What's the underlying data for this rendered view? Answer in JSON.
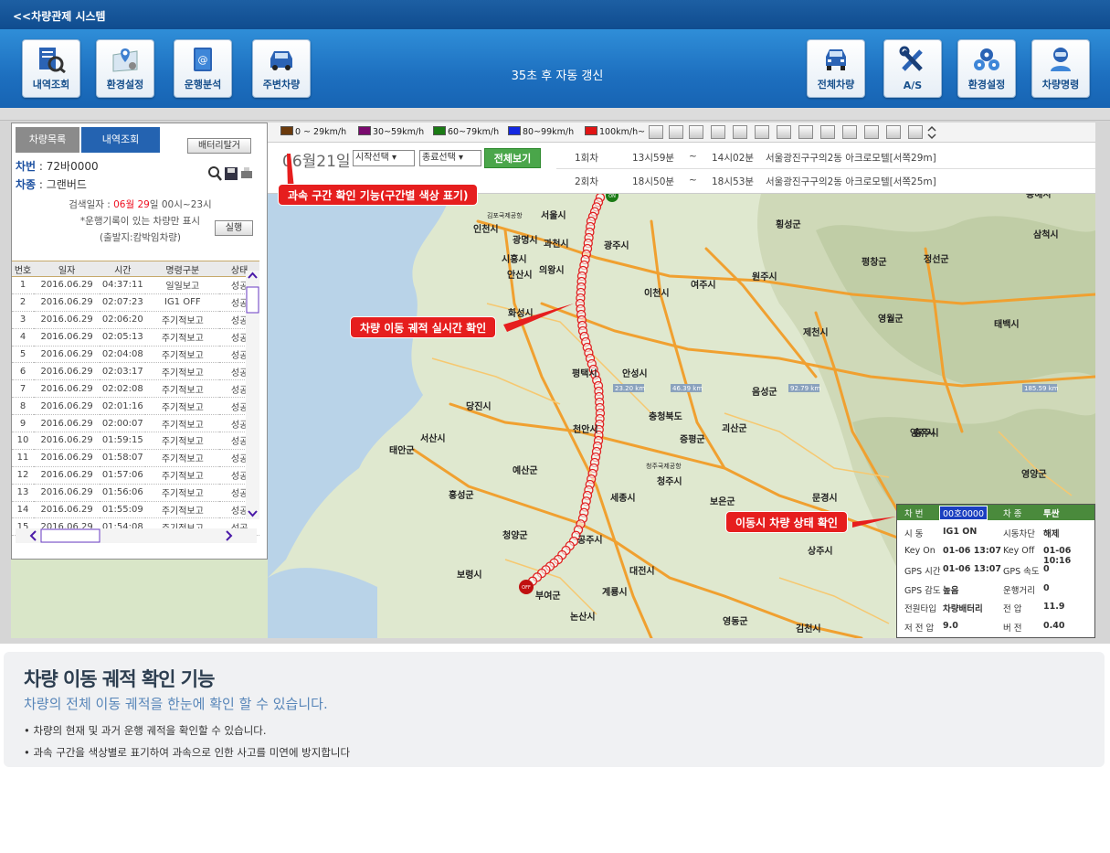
{
  "app": {
    "title": "<<차량관제 시스템"
  },
  "toolbar": {
    "left_buttons": [
      {
        "label": "내역조회",
        "icon": "history-search-icon"
      },
      {
        "label": "환경설정",
        "icon": "map-pin-settings-icon"
      },
      {
        "label": "운행분석",
        "icon": "analysis-notebook-icon"
      },
      {
        "label": "주변차량",
        "icon": "nearby-car-icon"
      }
    ],
    "refresh_text": "35초 후 자동 갱신",
    "right_buttons": [
      {
        "label": "전체차량",
        "icon": "all-vehicles-icon"
      },
      {
        "label": "A/S",
        "icon": "tools-icon"
      },
      {
        "label": "환경설정",
        "icon": "gears-icon"
      },
      {
        "label": "차량명령",
        "icon": "robot-command-icon"
      }
    ]
  },
  "left_panel": {
    "tabs": [
      "차량목록",
      "내역조회"
    ],
    "battery_button": "배터리탈거",
    "plate_key": "차번",
    "plate_value": "72바0000",
    "type_key": "차종",
    "type_value": "그랜버드",
    "search_date_prefix": "검색일자 : ",
    "search_date_month": "06월",
    "search_date_day": "29",
    "search_date_suffix": "일 00시~23시",
    "note1": "*운행기록이 있는 차량만 표시",
    "note2": "(출발지:캄박임차량)",
    "run_button": "실행",
    "columns": [
      "번호",
      "일자",
      "시간",
      "명령구분",
      "상태"
    ],
    "rows": [
      [
        "1",
        "2016.06.29",
        "04:37:11",
        "일일보고",
        "성공"
      ],
      [
        "2",
        "2016.06.29",
        "02:07:23",
        "IG1 OFF",
        "성공"
      ],
      [
        "3",
        "2016.06.29",
        "02:06:20",
        "주기적보고",
        "성공"
      ],
      [
        "4",
        "2016.06.29",
        "02:05:13",
        "주기적보고",
        "성공"
      ],
      [
        "5",
        "2016.06.29",
        "02:04:08",
        "주기적보고",
        "성공"
      ],
      [
        "6",
        "2016.06.29",
        "02:03:17",
        "주기적보고",
        "성공"
      ],
      [
        "7",
        "2016.06.29",
        "02:02:08",
        "주기적보고",
        "성공"
      ],
      [
        "8",
        "2016.06.29",
        "02:01:16",
        "주기적보고",
        "성공"
      ],
      [
        "9",
        "2016.06.29",
        "02:00:07",
        "주기적보고",
        "성공"
      ],
      [
        "10",
        "2016.06.29",
        "01:59:15",
        "주기적보고",
        "성공"
      ],
      [
        "11",
        "2016.06.29",
        "01:58:07",
        "주기적보고",
        "성공"
      ],
      [
        "12",
        "2016.06.29",
        "01:57:06",
        "주기적보고",
        "성공"
      ],
      [
        "13",
        "2016.06.29",
        "01:56:06",
        "주기적보고",
        "성공"
      ],
      [
        "14",
        "2016.06.29",
        "01:55:09",
        "주기적보고",
        "성공"
      ],
      [
        "15",
        "2016.06.29",
        "01:54:08",
        "주기적보고",
        "성공"
      ]
    ]
  },
  "map_toolbar": {
    "legend": [
      {
        "label": "0 ~ 29km/h",
        "color": "#6b3a0c"
      },
      {
        "label": "30~59km/h",
        "color": "#7a0a6e"
      },
      {
        "label": "60~79km/h",
        "color": "#1a7a14"
      },
      {
        "label": "80~99km/h",
        "color": "#1428e0"
      },
      {
        "label": "100km/h~",
        "color": "#e01414"
      }
    ]
  },
  "date_bar": {
    "date": "06월21일",
    "start_select": "시작선택",
    "end_select": "종료선택",
    "show_button": "전체보기",
    "trips": [
      {
        "no": "1회차",
        "start": "13시59분",
        "sep": "~",
        "end": "14시02분",
        "place": "서울광진구구의2동 아크로모텔[서쪽29m]"
      },
      {
        "no": "2회차",
        "start": "18시50분",
        "sep": "~",
        "end": "18시53분",
        "place": "서울광진구구의2동 아크로모텔[서쪽25m]"
      }
    ]
  },
  "map": {
    "cities": [
      {
        "name": "서울시"
      },
      {
        "name": "인천시"
      },
      {
        "name": "광명시"
      },
      {
        "name": "과천시"
      },
      {
        "name": "광주시"
      },
      {
        "name": "시흥시"
      },
      {
        "name": "의왕시"
      },
      {
        "name": "안산시"
      },
      {
        "name": "화성시"
      },
      {
        "name": "이천시"
      },
      {
        "name": "여주시"
      },
      {
        "name": "원주시"
      },
      {
        "name": "횡성군"
      },
      {
        "name": "평창군"
      },
      {
        "name": "정선군"
      },
      {
        "name": "영월군"
      },
      {
        "name": "태백시"
      },
      {
        "name": "제천시"
      },
      {
        "name": "충주시"
      },
      {
        "name": "음성군"
      },
      {
        "name": "평택시"
      },
      {
        "name": "안성시"
      },
      {
        "name": "당진시"
      },
      {
        "name": "충청북도"
      },
      {
        "name": "증평군"
      },
      {
        "name": "괴산군"
      },
      {
        "name": "천안시"
      },
      {
        "name": "서산시"
      },
      {
        "name": "태안군"
      },
      {
        "name": "예산군"
      },
      {
        "name": "청주시"
      },
      {
        "name": "홍성군"
      },
      {
        "name": "세종시"
      },
      {
        "name": "청양군"
      },
      {
        "name": "공주시"
      },
      {
        "name": "보령시"
      },
      {
        "name": "부여군"
      },
      {
        "name": "계룡시"
      },
      {
        "name": "대전시"
      },
      {
        "name": "논산시"
      },
      {
        "name": "상주시"
      },
      {
        "name": "영동군"
      },
      {
        "name": "김천시"
      },
      {
        "name": "예천군"
      },
      {
        "name": "영주시"
      },
      {
        "name": "영양군"
      },
      {
        "name": "삼척시"
      },
      {
        "name": "동해시"
      },
      {
        "name": "문경시"
      },
      {
        "name": "보은군"
      },
      {
        "name": "청주국제공항"
      },
      {
        "name": "김포국제공항"
      }
    ],
    "distance_badges": [
      "23.20 km",
      "46.39 km",
      "92.79 km",
      "185.59 km"
    ],
    "start_badge": "ON",
    "end_badge": "OFF"
  },
  "callouts": {
    "speed": "과속 구간 확인 기능(구간별 색상 표기)",
    "track": "차량 이동 궤적 실시간 확인",
    "status": "이동시 차량 상태 확인"
  },
  "status_panel": {
    "plate_key": "차   번",
    "plate_value": "00호0000",
    "type_key": "차   종",
    "type_value": "투싼",
    "rows": [
      {
        "k1": "시   동",
        "v1": "IG1 ON",
        "k2": "시동차단",
        "v2": "해제"
      },
      {
        "k1": "Key On",
        "v1": "01-06 13:07",
        "k2": "Key Off",
        "v2": "01-06 10:16"
      },
      {
        "k1": "GPS 시간",
        "v1": "01-06 13:07",
        "k2": "GPS 속도",
        "v2": "0"
      },
      {
        "k1": "GPS 감도",
        "v1": "높음",
        "k2": "운행거리",
        "v2": "0"
      },
      {
        "k1": "전원타입",
        "v1": "차량배터리",
        "k2": "전     압",
        "v2": "11.9"
      },
      {
        "k1": "저 전 압",
        "v1": "9.0",
        "k2": "버     전",
        "v2": "0.40"
      }
    ]
  },
  "description": {
    "title": "차량 이동 궤적 확인 기능",
    "subtitle": "차량의 전체 이동 궤적을 한눈에 확인 할 수 있습니다.",
    "bullets": [
      "• 차량의 현재 및 과거 운행 궤적을 확인할 수 있습니다.",
      "• 과속 구간을  색상별로 표기하여  과속으로 인한 사고를  미연에 방지합니다"
    ]
  }
}
